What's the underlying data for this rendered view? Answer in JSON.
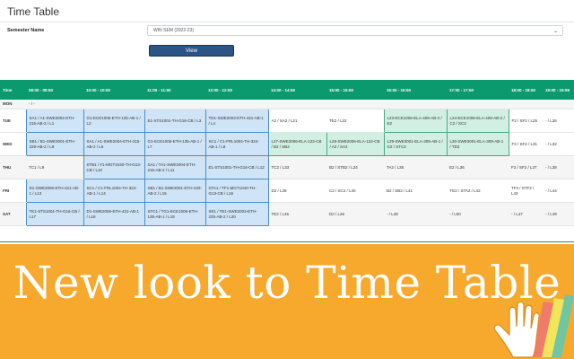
{
  "page": {
    "title": "Time Table"
  },
  "semester": {
    "label": "Semester Name",
    "selected": "WIN SEM (2022-23)"
  },
  "view_button": {
    "label": "View"
  },
  "timetable": {
    "headers": [
      "Time",
      "08:00 - 08:50",
      "10:00 - 10:50",
      "11:00 - 11:50",
      "12:00 - 12:50",
      "14:00 - 14:50",
      "15:00 - 15:50",
      "16:00 - 16:50",
      "17:00 - 17:50",
      "18:00 - 18:50",
      "19:00 - 19:59"
    ],
    "rows": [
      {
        "day": "MON",
        "cells": [
          "- / -",
          "",
          "",
          "",
          "",
          "",
          "",
          "",
          "",
          ""
        ]
      },
      {
        "day": "TUE",
        "cells": [
          "SA1 / A1-SWE2004-ETH-215-AB-2 / L1",
          "G1-ECE1006-ETH-135-AB-1 / L2",
          "E1-STS1001-TH-G16-CB / L3",
          "TD1-SWE2003-ETH-421-AB-1 / L4",
          "A2 / SA2 / L21",
          "TE2 / L22",
          "L23-ECE1006-ELA-409-AB-2 / E2",
          "L24-ECE1006-ELA-409-AB-2 / C2 / SC2",
          "F2 / SF2 / L25",
          "- / L26"
        ]
      },
      {
        "day": "WED",
        "cells": [
          "SB1 / B1-SWE3001-ETH-229-AB-2 / L9",
          "SA1 / A1-SWE2004-ETH-215-AB-2 / L6",
          "G1-ECE1006-ETH-135-AB-1 / L7",
          "SC1 / C1-FRL1004-TH-324-AB-1 / L8",
          "L27-SWE2006-ELA-122-CB / B2 / SB2",
          "L28-SWE2006-ELA-122-CB / A2 / SA2",
          "L29-SWE3001-ELA-309-AB-1 / G2 / STC2",
          "L30-SWE3001-ELA-309-AB-1 / TD2",
          "F2 / SF2 / L31",
          "- / L32"
        ]
      },
      {
        "day": "THU",
        "cells": [
          "TC1 / L9",
          "STB1 / F1-MGT1040-TH-G13-CB / L10",
          "SA1 / TA1-SWE2004-ETH-215-AB-2 / L11",
          "E1-STS1001-TH-G16-CB / L12",
          "TC2 / L33",
          "B2 / STB2 / L34",
          "TA2 / L35",
          "E2 / L36",
          "F2 / SF2 / L37",
          "- / L38"
        ]
      },
      {
        "day": "FRI",
        "cells": [
          "D1-SWE2006-ETH-421-AB-1 / L13",
          "SC1 / C1-FRL1004-TH-324-AB-1 / L14",
          "SB1 / B1-SWE3001-ETH-229-AB-2 / L15",
          "STA1 / TF1-MGT1040-TH-G13-CB / L16",
          "D2 / L39",
          "C2 / SC2 / L40",
          "B2 / SB2 / L41",
          "TG2 / STA2 / L42",
          "TF2 / STF2 / L43",
          "- / L44"
        ]
      },
      {
        "day": "SAT",
        "cells": [
          "TE1-STS1001-TH-G16-CB / L17",
          "D1-SWE2006-ETH-421-AB-1 / L18",
          "STC1 / TG1-ECE1006-ETH-135-AB-1 / L19",
          "SE1 / TE1-SWE2003-ETH-225-AB-2 / L20",
          "TE2 / L45",
          "D2 / L46",
          "- / L48",
          "- / L50",
          "- / L47",
          "- / L49"
        ]
      }
    ]
  },
  "banner": {
    "text": "New look to Time Table",
    "bg_color": "#f7a92d",
    "text_color": "#ffffff",
    "icon": "hand-wave-icon"
  },
  "colors": {
    "header": "#0a9a6d",
    "theory": "#cfe4f6",
    "theory_border": "#4a8ec8",
    "lab": "#d2efe3",
    "lab_border": "#46a882",
    "button": "#2a5585"
  }
}
